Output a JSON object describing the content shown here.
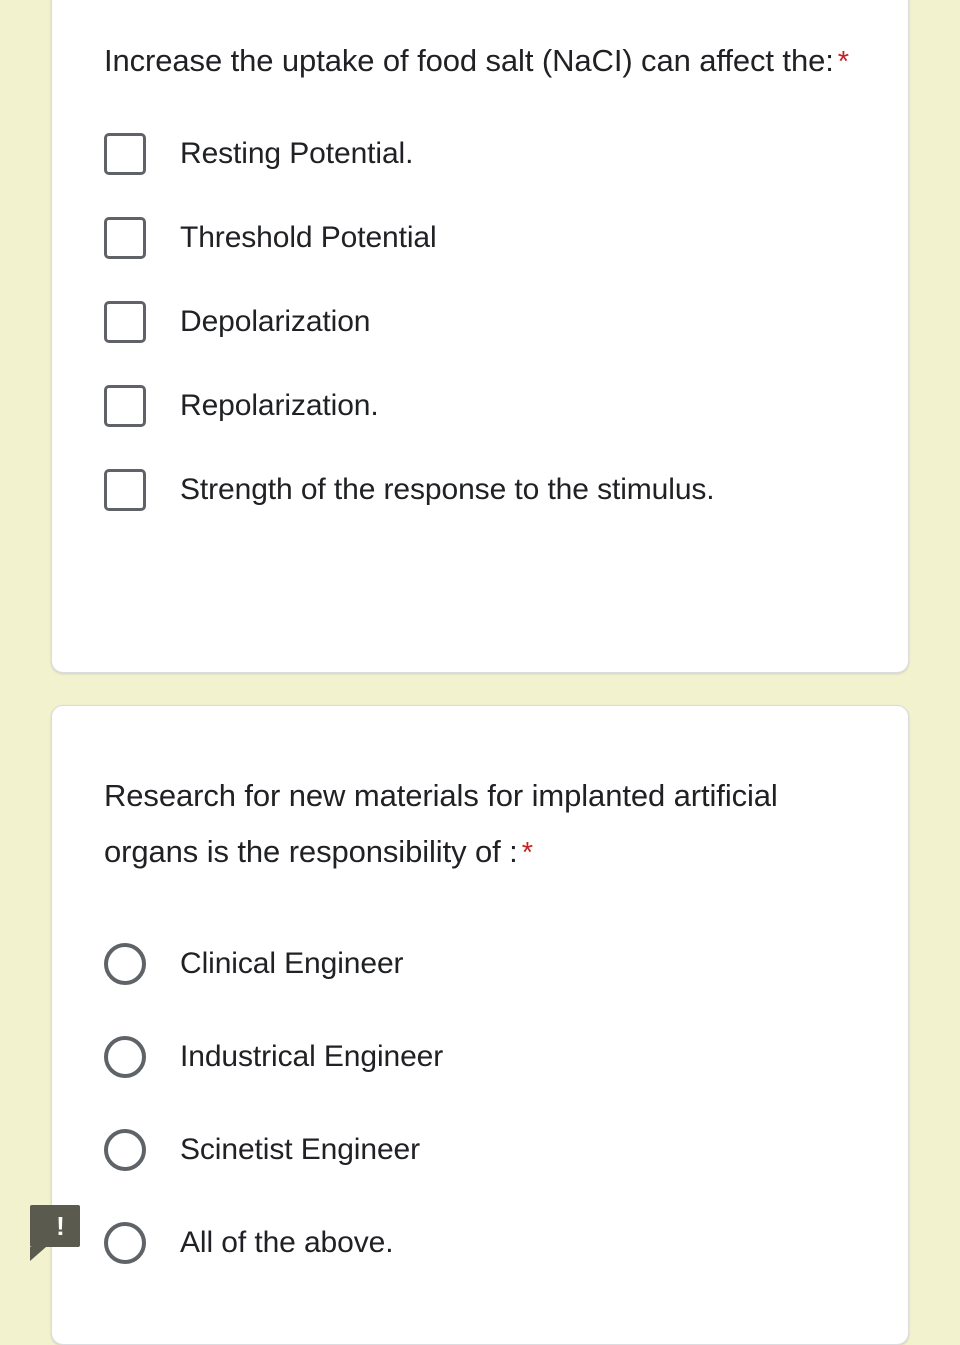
{
  "theme": {
    "page_background": "#f2f2cf",
    "card_background": "#ffffff",
    "text_color": "#202124",
    "control_border": "#5f6368",
    "required_color": "#c5221f",
    "badge_color": "#5a5a4e"
  },
  "questions": [
    {
      "id": "q1",
      "title": "Increase the uptake of food salt (NaCI) can affect the:",
      "required_marker": "*",
      "input_type": "checkbox",
      "options": [
        {
          "label": "Resting Potential.",
          "checked": false
        },
        {
          "label": "Threshold Potential",
          "checked": false
        },
        {
          "label": "Depolarization",
          "checked": false
        },
        {
          "label": "Repolarization.",
          "checked": false
        },
        {
          "label": "Strength of the response to the stimulus.",
          "checked": false
        }
      ]
    },
    {
      "id": "q2",
      "title": "Research for new materials for implanted artificial organs is the responsibility of :",
      "required_marker": "*",
      "input_type": "radio",
      "options": [
        {
          "label": "Clinical Engineer",
          "selected": false
        },
        {
          "label": "Industrical Engineer",
          "selected": false
        },
        {
          "label": "Scinetist Engineer",
          "selected": false
        },
        {
          "label": "All of the above.",
          "selected": false
        }
      ]
    }
  ],
  "alert_badge": {
    "icon": "exclamation-badge-icon",
    "glyph": "!"
  }
}
